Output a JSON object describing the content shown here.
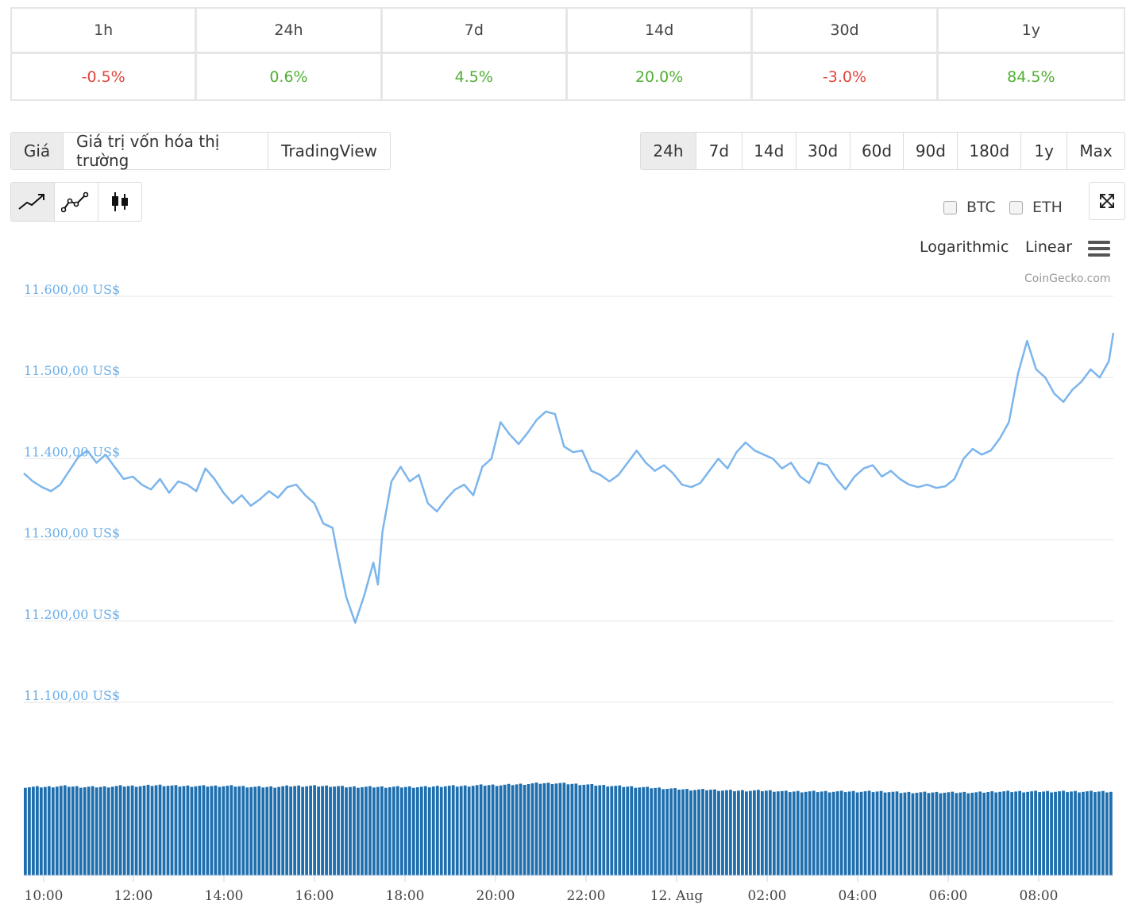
{
  "performance": [
    {
      "period": "1h",
      "change": "-0.5%",
      "dir": "neg"
    },
    {
      "period": "24h",
      "change": "0.6%",
      "dir": "pos"
    },
    {
      "period": "7d",
      "change": "4.5%",
      "dir": "pos"
    },
    {
      "period": "14d",
      "change": "20.0%",
      "dir": "pos"
    },
    {
      "period": "30d",
      "change": "-3.0%",
      "dir": "neg"
    },
    {
      "period": "1y",
      "change": "84.5%",
      "dir": "pos"
    }
  ],
  "view_tabs": {
    "price": "Giá",
    "market_cap": "Giá trị vốn hóa thị trường",
    "tradingview": "TradingView",
    "active": "price"
  },
  "range_tabs": {
    "items": [
      "24h",
      "7d",
      "14d",
      "30d",
      "60d",
      "90d",
      "180d",
      "1y",
      "Max"
    ],
    "active": "24h"
  },
  "chart_type_icons": [
    "line-chart-icon",
    "point-line-chart-icon",
    "candlestick-icon"
  ],
  "compare": {
    "btc": "BTC",
    "eth": "ETH"
  },
  "scale": {
    "log": "Logarithmic",
    "linear": "Linear"
  },
  "credit": "CoinGecko.com",
  "colors": {
    "line": "#7cb5ec",
    "volume": "#1f6fae",
    "positive": "#4fae32",
    "negative": "#e0453b"
  },
  "chart_data": {
    "type": "line",
    "y_tick_labels": [
      "11.600,00 US$",
      "11.500,00 US$",
      "11.400,00 US$",
      "11.300,00 US$",
      "11.200,00 US$",
      "11.100,00 US$"
    ],
    "y_ticks": [
      11600,
      11500,
      11400,
      11300,
      11200,
      11100
    ],
    "ylim": [
      11100,
      11600
    ],
    "x_tick_labels": [
      "10:00",
      "12:00",
      "14:00",
      "16:00",
      "18:00",
      "20:00",
      "22:00",
      "12. Aug",
      "02:00",
      "04:00",
      "06:00",
      "08:00"
    ],
    "x_range_hours": [
      9.6,
      33.6
    ],
    "grid": true,
    "price_series": [
      [
        9.6,
        11382
      ],
      [
        9.8,
        11372
      ],
      [
        10.0,
        11365
      ],
      [
        10.2,
        11360
      ],
      [
        10.4,
        11368
      ],
      [
        10.6,
        11385
      ],
      [
        10.8,
        11402
      ],
      [
        11.0,
        11410
      ],
      [
        11.2,
        11395
      ],
      [
        11.4,
        11405
      ],
      [
        11.6,
        11390
      ],
      [
        11.8,
        11375
      ],
      [
        12.0,
        11378
      ],
      [
        12.2,
        11368
      ],
      [
        12.4,
        11362
      ],
      [
        12.6,
        11375
      ],
      [
        12.8,
        11358
      ],
      [
        13.0,
        11372
      ],
      [
        13.2,
        11368
      ],
      [
        13.4,
        11360
      ],
      [
        13.6,
        11388
      ],
      [
        13.8,
        11375
      ],
      [
        14.0,
        11358
      ],
      [
        14.2,
        11345
      ],
      [
        14.4,
        11355
      ],
      [
        14.6,
        11342
      ],
      [
        14.8,
        11350
      ],
      [
        15.0,
        11360
      ],
      [
        15.2,
        11352
      ],
      [
        15.4,
        11365
      ],
      [
        15.6,
        11368
      ],
      [
        15.8,
        11355
      ],
      [
        16.0,
        11345
      ],
      [
        16.2,
        11320
      ],
      [
        16.4,
        11315
      ],
      [
        16.5,
        11285
      ],
      [
        16.7,
        11230
      ],
      [
        16.9,
        11198
      ],
      [
        17.1,
        11232
      ],
      [
        17.3,
        11272
      ],
      [
        17.4,
        11245
      ],
      [
        17.5,
        11310
      ],
      [
        17.7,
        11372
      ],
      [
        17.9,
        11390
      ],
      [
        18.1,
        11372
      ],
      [
        18.3,
        11380
      ],
      [
        18.5,
        11345
      ],
      [
        18.7,
        11335
      ],
      [
        18.9,
        11350
      ],
      [
        19.1,
        11362
      ],
      [
        19.3,
        11368
      ],
      [
        19.5,
        11355
      ],
      [
        19.7,
        11390
      ],
      [
        19.9,
        11400
      ],
      [
        20.1,
        11445
      ],
      [
        20.3,
        11430
      ],
      [
        20.5,
        11418
      ],
      [
        20.7,
        11432
      ],
      [
        20.9,
        11448
      ],
      [
        21.1,
        11458
      ],
      [
        21.3,
        11455
      ],
      [
        21.5,
        11415
      ],
      [
        21.7,
        11408
      ],
      [
        21.9,
        11410
      ],
      [
        22.1,
        11385
      ],
      [
        22.3,
        11380
      ],
      [
        22.5,
        11372
      ],
      [
        22.7,
        11380
      ],
      [
        22.9,
        11395
      ],
      [
        23.1,
        11410
      ],
      [
        23.3,
        11395
      ],
      [
        23.5,
        11385
      ],
      [
        23.7,
        11392
      ],
      [
        23.9,
        11382
      ],
      [
        24.1,
        11368
      ],
      [
        24.3,
        11365
      ],
      [
        24.5,
        11370
      ],
      [
        24.7,
        11385
      ],
      [
        24.9,
        11400
      ],
      [
        25.1,
        11388
      ],
      [
        25.3,
        11408
      ],
      [
        25.5,
        11420
      ],
      [
        25.7,
        11410
      ],
      [
        25.9,
        11405
      ],
      [
        26.1,
        11400
      ],
      [
        26.3,
        11388
      ],
      [
        26.5,
        11395
      ],
      [
        26.7,
        11378
      ],
      [
        26.9,
        11370
      ],
      [
        27.1,
        11395
      ],
      [
        27.3,
        11392
      ],
      [
        27.5,
        11375
      ],
      [
        27.7,
        11362
      ],
      [
        27.9,
        11378
      ],
      [
        28.1,
        11388
      ],
      [
        28.3,
        11392
      ],
      [
        28.5,
        11378
      ],
      [
        28.7,
        11385
      ],
      [
        28.9,
        11375
      ],
      [
        29.1,
        11368
      ],
      [
        29.3,
        11365
      ],
      [
        29.5,
        11368
      ],
      [
        29.7,
        11364
      ],
      [
        29.9,
        11366
      ],
      [
        30.1,
        11375
      ],
      [
        30.3,
        11400
      ],
      [
        30.5,
        11412
      ],
      [
        30.7,
        11405
      ],
      [
        30.9,
        11410
      ],
      [
        31.1,
        11425
      ],
      [
        31.3,
        11445
      ],
      [
        31.5,
        11505
      ],
      [
        31.7,
        11545
      ],
      [
        31.9,
        11510
      ],
      [
        32.1,
        11500
      ],
      [
        32.3,
        11480
      ],
      [
        32.5,
        11470
      ],
      [
        32.7,
        11485
      ],
      [
        32.9,
        11495
      ],
      [
        33.1,
        11510
      ],
      [
        33.3,
        11500
      ],
      [
        33.5,
        11520
      ],
      [
        33.6,
        11555
      ]
    ],
    "volume_series_relative": [
      0.96,
      0.96,
      0.97,
      0.96,
      0.96,
      0.97,
      0.97,
      0.98,
      0.97,
      0.97,
      0.97,
      0.97,
      0.96,
      0.96,
      0.97,
      0.97,
      0.97,
      0.96,
      0.96,
      0.96,
      0.96,
      0.96,
      0.97,
      0.97,
      0.98,
      0.98,
      0.99,
      1.0,
      1.0,
      0.99,
      0.98,
      0.97,
      0.96,
      0.95,
      0.94,
      0.93,
      0.93,
      0.92,
      0.92,
      0.92,
      0.91,
      0.91,
      0.91,
      0.91,
      0.91,
      0.91,
      0.9,
      0.9,
      0.9,
      0.9,
      0.9,
      0.91,
      0.91,
      0.91,
      0.91,
      0.91,
      0.91,
      0.91
    ]
  }
}
